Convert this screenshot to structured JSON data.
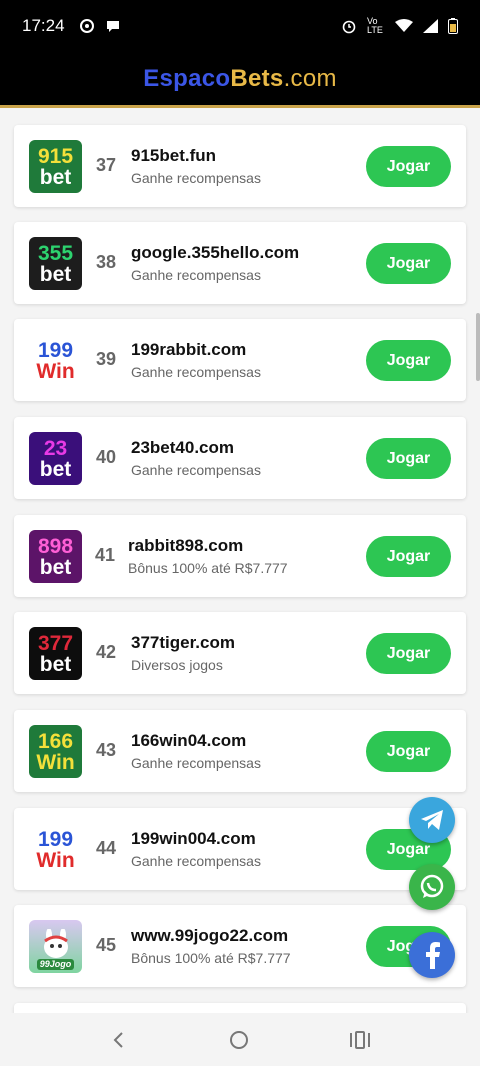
{
  "status_bar": {
    "time": "17:24",
    "network": "Vo LTE"
  },
  "header": {
    "brand_part1": "Espaco",
    "brand_part2": "Bets",
    "brand_part3": ".com"
  },
  "items": [
    {
      "logo_top": "915",
      "logo_bottom": "bet",
      "rank": "37",
      "name": "915bet.fun",
      "desc": "Ganhe recompensas",
      "button": "Jogar"
    },
    {
      "logo_top": "355",
      "logo_bottom": "bet",
      "rank": "38",
      "name": "google.355hello.com",
      "desc": "Ganhe recompensas",
      "button": "Jogar"
    },
    {
      "logo_top": "199",
      "logo_bottom": "Win",
      "rank": "39",
      "name": "199rabbit.com",
      "desc": "Ganhe recompensas",
      "button": "Jogar"
    },
    {
      "logo_top": "23",
      "logo_bottom": "bet",
      "rank": "40",
      "name": "23bet40.com",
      "desc": "Ganhe recompensas",
      "button": "Jogar"
    },
    {
      "logo_top": "898",
      "logo_bottom": "bet",
      "rank": "41",
      "name": "rabbit898.com",
      "desc": "Bônus 100% até R$7.777",
      "button": "Jogar"
    },
    {
      "logo_top": "377",
      "logo_bottom": "bet",
      "rank": "42",
      "name": "377tiger.com",
      "desc": "Diversos jogos",
      "button": "Jogar"
    },
    {
      "logo_top": "166",
      "logo_bottom": "Win",
      "rank": "43",
      "name": "166win04.com",
      "desc": "Ganhe recompensas",
      "button": "Jogar"
    },
    {
      "logo_top": "199",
      "logo_bottom": "Win",
      "rank": "44",
      "name": "199win004.com",
      "desc": "Ganhe recompensas",
      "button": "Jogar"
    },
    {
      "logo_top": "",
      "logo_bottom": "99Jogo",
      "rank": "45",
      "name": "www.99jogo22.com",
      "desc": "Bônus 100% até R$7.777",
      "button": "Jogar"
    }
  ],
  "colors": {
    "accent_green": "#2dc653",
    "brand_blue": "#3b56e6",
    "brand_gold": "#e8b947"
  },
  "icons": {
    "telegram": "telegram-icon",
    "whatsapp": "whatsapp-icon",
    "facebook": "facebook-icon"
  }
}
